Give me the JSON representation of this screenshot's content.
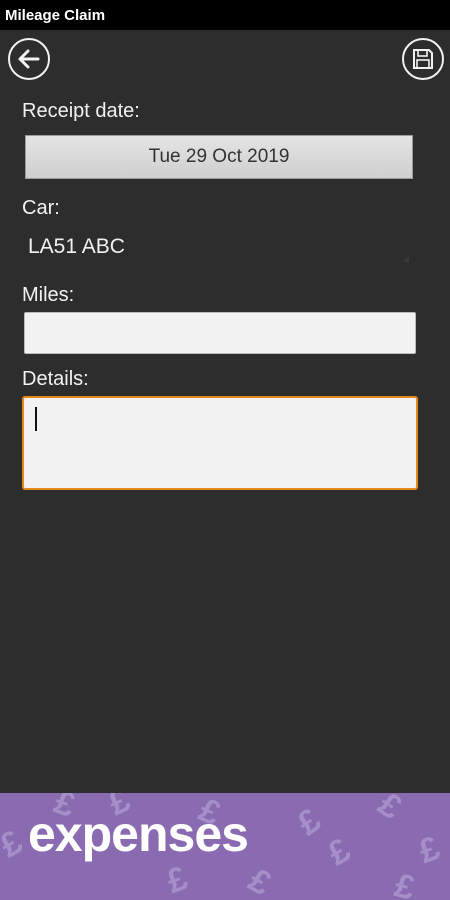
{
  "title_bar": {
    "title": "Mileage Claim"
  },
  "toolbar": {
    "back_icon": "arrow-left-icon",
    "save_icon": "save-icon"
  },
  "form": {
    "receipt_date_label": "Receipt date:",
    "receipt_date_value": "Tue 29 Oct 2019",
    "car_label": "Car:",
    "car_value": "LA51 ABC",
    "miles_label": "Miles:",
    "miles_value": "",
    "details_label": "Details:",
    "details_value": ""
  },
  "banner": {
    "text": "expenses",
    "watermark_glyph": "£",
    "background_color": "#8a6bb1"
  },
  "colors": {
    "background": "#2d2d2d",
    "title_bar": "#000000",
    "focus_border": "#e38a1a"
  }
}
